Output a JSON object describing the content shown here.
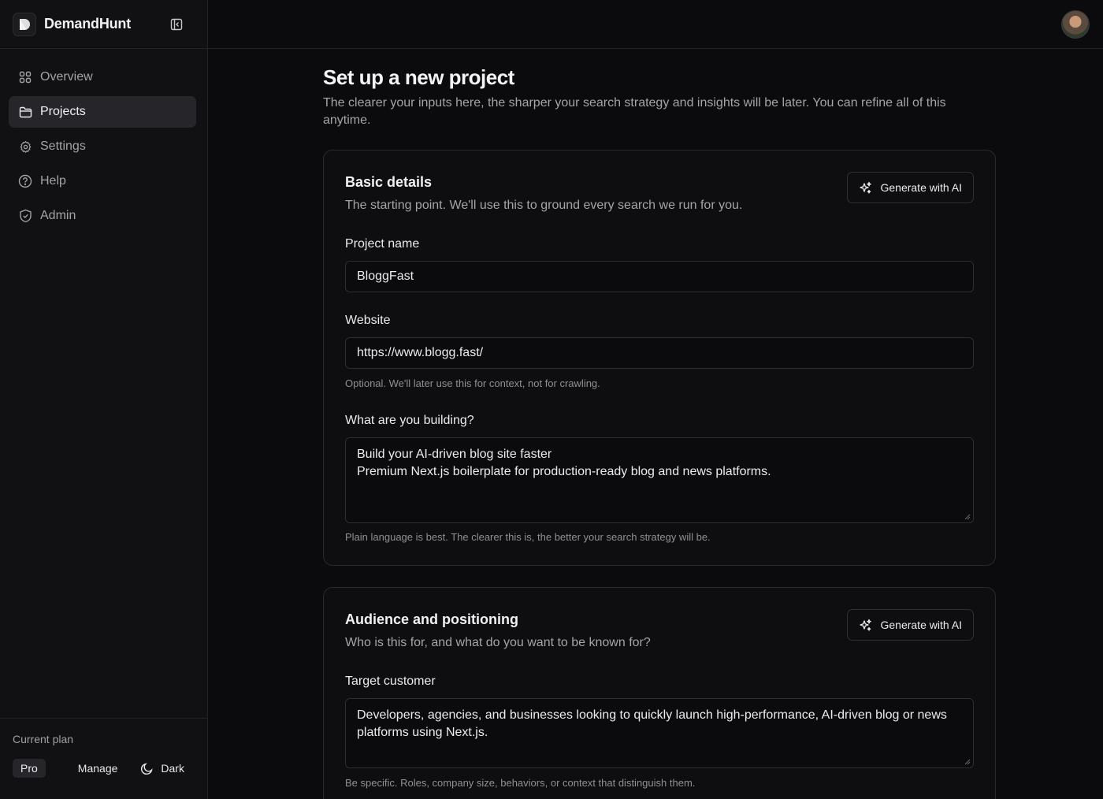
{
  "sidebar": {
    "brand": "DemandHunt",
    "items": [
      {
        "label": "Overview",
        "icon": "grid-icon"
      },
      {
        "label": "Projects",
        "icon": "folder-icon",
        "active": true
      },
      {
        "label": "Settings",
        "icon": "gear-icon"
      },
      {
        "label": "Help",
        "icon": "help-circle-icon"
      },
      {
        "label": "Admin",
        "icon": "shield-icon"
      }
    ],
    "plan": {
      "label": "Current plan",
      "badge": "Pro",
      "manage": "Manage",
      "theme": "Dark"
    }
  },
  "page": {
    "title": "Set up a new project",
    "subtitle": "The clearer your inputs here, the sharper your search strategy and insights will be later. You can refine all of this anytime."
  },
  "basic": {
    "title": "Basic details",
    "subtitle": "The starting point. We'll use this to ground every search we run for you.",
    "ai_button": "Generate with AI",
    "project_name": {
      "label": "Project name",
      "value": "BloggFast"
    },
    "website": {
      "label": "Website",
      "value": "https://www.blogg.fast/",
      "hint": "Optional. We'll later use this for context, not for crawling."
    },
    "building": {
      "label": "What are you building?",
      "line1": "Build your AI-driven blog site faster",
      "line2": "Premium Next.js boilerplate for production-ready blog and news platforms.",
      "hint": "Plain language is best. The clearer this is, the better your search strategy will be."
    }
  },
  "audience": {
    "title": "Audience and positioning",
    "subtitle": "Who is this for, and what do you want to be known for?",
    "ai_button": "Generate with AI",
    "target": {
      "label": "Target customer",
      "value": "Developers, agencies, and businesses looking to quickly launch high-performance, AI-driven blog or news platforms using Next.js.",
      "hint": "Be specific. Roles, company size, behaviors, or context that distinguish them."
    }
  }
}
